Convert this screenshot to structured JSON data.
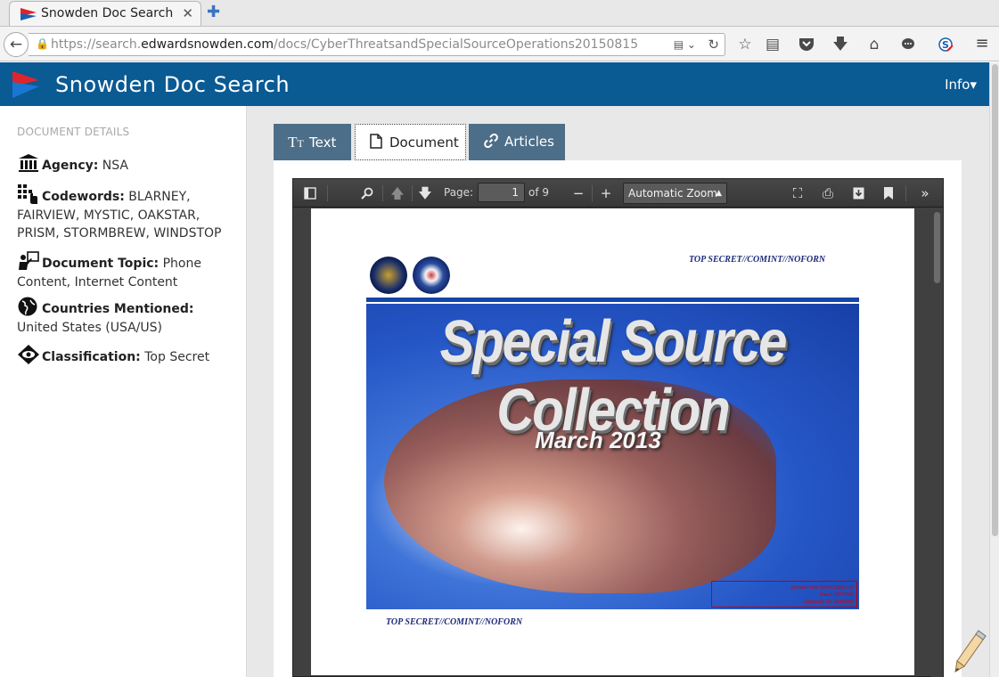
{
  "browser": {
    "tab_title": "Snowden Doc Search",
    "tab_close": "✕",
    "new_tab": "✚",
    "url_prefix": "https://search.",
    "url_domain": "edwardsnowden.com",
    "url_path": "/docs/CyberThreatsandSpecialSourceOperations20150815",
    "back": "←",
    "reload": "↻",
    "reader_icon": "▤ ⌄",
    "toolbar_icons": [
      "star-icon",
      "reading-list-icon",
      "pocket-icon",
      "download-icon",
      "home-icon",
      "chat-icon",
      "extension-icon"
    ],
    "menu": "≡"
  },
  "site": {
    "brand": "Snowden Doc Search",
    "info_menu": "Info▾",
    "colors": {
      "header": "#0a5a94",
      "tab": "#4d6e88",
      "logo_red": "#e0242b"
    }
  },
  "sidebar": {
    "heading": "DOCUMENT DETAILS",
    "details": [
      {
        "icon": "building-icon",
        "label": "Agency:",
        "value": "NSA"
      },
      {
        "icon": "codewords-icon",
        "label": "Codewords:",
        "value": "BLARNEY, FAIRVIEW, MYSTIC, OAKSTAR, PRISM, STORMBREW, WINDSTOP"
      },
      {
        "icon": "presenter-icon",
        "label": "Document Topic:",
        "value": "Phone Content, Internet Content"
      },
      {
        "icon": "globe-icon",
        "label": "Countries Mentioned:",
        "value": "United States (USA/US)"
      },
      {
        "icon": "eye-icon",
        "label": "Classification:",
        "value": "Top Secret"
      }
    ]
  },
  "tabs": [
    {
      "icon": "TT",
      "label": "Text"
    },
    {
      "icon": "🗋",
      "label": "Document"
    },
    {
      "icon": "🔗",
      "label": "Articles"
    }
  ],
  "pdf": {
    "page_label": "Page:",
    "page": "1",
    "of_pages": "of 9",
    "zoom": "Automatic Zoom",
    "classification_top": "TOP SECRET//COMINT//NOFORN",
    "classification_bottom": "TOP SECRET//COMINT//NOFORN",
    "cover_title": "Special Source Collection",
    "cover_date": "March 2013",
    "declass": [
      "Derived From: NSA/CSSM 1-52",
      "Dated: 20070108",
      "Declassify On: 20380301"
    ]
  }
}
